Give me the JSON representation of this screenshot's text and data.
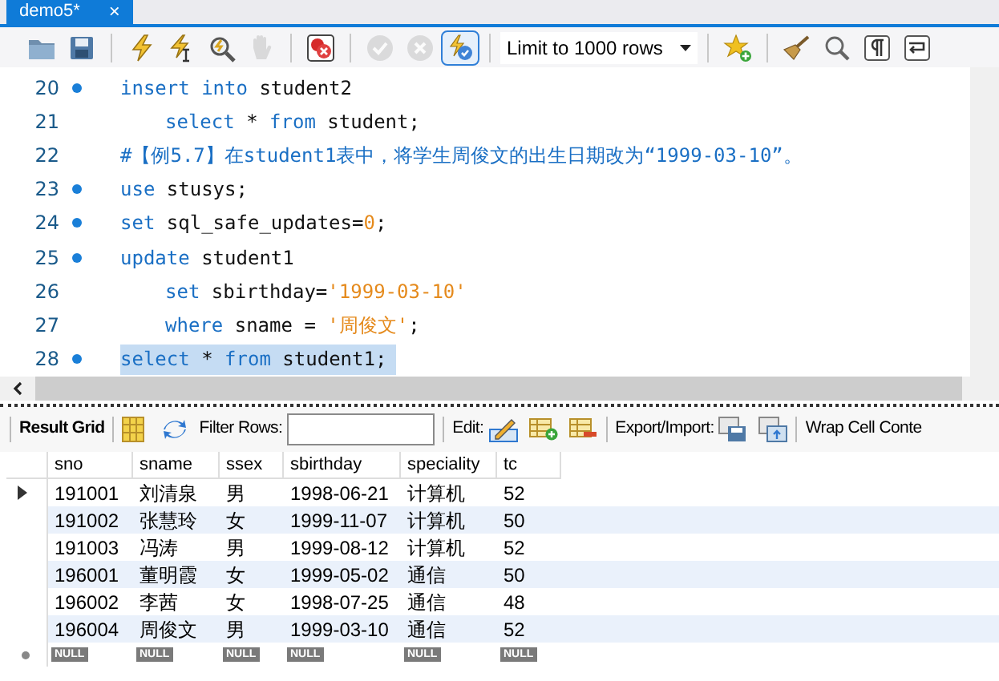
{
  "tab": {
    "title": "demo5*",
    "close": "×"
  },
  "toolbar": [
    {
      "kind": "folder",
      "disabled": false
    },
    {
      "kind": "save",
      "disabled": false
    },
    {
      "kind": "sep"
    },
    {
      "kind": "bolt",
      "disabled": false
    },
    {
      "kind": "bolt-cursor",
      "disabled": false
    },
    {
      "kind": "bolt-magnifier",
      "disabled": false
    },
    {
      "kind": "hand",
      "disabled": true
    },
    {
      "kind": "sep"
    },
    {
      "kind": "stop",
      "disabled": false
    },
    {
      "kind": "sep"
    },
    {
      "kind": "check",
      "disabled": true
    },
    {
      "kind": "cancel",
      "disabled": true
    },
    {
      "kind": "toggle",
      "disabled": false,
      "selected": true
    }
  ],
  "limit": {
    "value": "Limit to 1000 rows"
  },
  "toolbar_right": [
    {
      "kind": "star"
    },
    {
      "kind": "sep"
    },
    {
      "kind": "broom"
    },
    {
      "kind": "magnifier"
    },
    {
      "kind": "pilcrow"
    },
    {
      "kind": "wrap"
    }
  ],
  "editor": {
    "lines": [
      {
        "number": "20",
        "marker": true,
        "indent": false,
        "selected": false,
        "tokens": [
          {
            "kind": "keyword",
            "text": "insert into"
          },
          {
            "kind": "plain",
            "text": " student2"
          }
        ]
      },
      {
        "number": "21",
        "marker": false,
        "indent": true,
        "selected": false,
        "tokens": [
          {
            "kind": "keyword",
            "text": "select"
          },
          {
            "kind": "plain",
            "text": " * "
          },
          {
            "kind": "keyword",
            "text": "from"
          },
          {
            "kind": "plain",
            "text": " student;"
          }
        ]
      },
      {
        "number": "22",
        "marker": false,
        "indent": false,
        "selected": false,
        "tokens": [
          {
            "kind": "comment",
            "text": "#【例5.7】在student1表中，将学生周俊文的出生日期改为“1999-03-10”。"
          }
        ]
      },
      {
        "number": "23",
        "marker": true,
        "indent": false,
        "selected": false,
        "tokens": [
          {
            "kind": "keyword",
            "text": "use"
          },
          {
            "kind": "plain",
            "text": " stusys;"
          }
        ]
      },
      {
        "number": "24",
        "marker": true,
        "indent": false,
        "selected": false,
        "tokens": [
          {
            "kind": "keyword",
            "text": "set"
          },
          {
            "kind": "plain",
            "text": " sql_safe_updates="
          },
          {
            "kind": "number",
            "text": "0"
          },
          {
            "kind": "plain",
            "text": ";"
          }
        ]
      },
      {
        "number": "25",
        "marker": true,
        "indent": false,
        "selected": false,
        "tokens": [
          {
            "kind": "keyword",
            "text": "update"
          },
          {
            "kind": "plain",
            "text": " student1"
          }
        ]
      },
      {
        "number": "26",
        "marker": false,
        "indent": true,
        "selected": false,
        "tokens": [
          {
            "kind": "keyword",
            "text": "set"
          },
          {
            "kind": "plain",
            "text": " sbirthday="
          },
          {
            "kind": "string",
            "text": "'1999-03-10'"
          }
        ]
      },
      {
        "number": "27",
        "marker": false,
        "indent": true,
        "selected": false,
        "tokens": [
          {
            "kind": "keyword",
            "text": "where"
          },
          {
            "kind": "plain",
            "text": " sname = "
          },
          {
            "kind": "string",
            "text": "'周俊文'"
          },
          {
            "kind": "plain",
            "text": ";"
          }
        ]
      },
      {
        "number": "28",
        "marker": true,
        "indent": false,
        "selected": true,
        "tokens": [
          {
            "kind": "keyword",
            "text": "select"
          },
          {
            "kind": "plain",
            "text": " * "
          },
          {
            "kind": "keyword",
            "text": "from"
          },
          {
            "kind": "plain",
            "text": " student1;"
          }
        ]
      }
    ]
  },
  "result_toolbar": {
    "result_grid": "Result Grid",
    "filter_label": "Filter Rows:",
    "edit_label": "Edit:",
    "export_label": "Export/Import:",
    "wrap_label": "Wrap Cell Conte"
  },
  "table": {
    "columns": [
      "sno",
      "sname",
      "ssex",
      "sbirthday",
      "speciality",
      "tc"
    ],
    "rows": [
      {
        "current": true,
        "cells": [
          "191001",
          "刘清泉",
          "男",
          "1998-06-21",
          "计算机",
          "52"
        ]
      },
      {
        "current": false,
        "cells": [
          "191002",
          "张慧玲",
          "女",
          "1999-11-07",
          "计算机",
          "50"
        ]
      },
      {
        "current": false,
        "cells": [
          "191003",
          "冯涛",
          "男",
          "1999-08-12",
          "计算机",
          "52"
        ]
      },
      {
        "current": false,
        "cells": [
          "196001",
          "董明霞",
          "女",
          "1999-05-02",
          "通信",
          "50"
        ]
      },
      {
        "current": false,
        "cells": [
          "196002",
          "李茜",
          "女",
          "1998-07-25",
          "通信",
          "48"
        ]
      },
      {
        "current": false,
        "cells": [
          "196004",
          "周俊文",
          "男",
          "1999-03-10",
          "通信",
          "52"
        ]
      }
    ],
    "new_row": [
      "NULL",
      "NULL",
      "NULL",
      "NULL",
      "NULL",
      "NULL"
    ]
  }
}
